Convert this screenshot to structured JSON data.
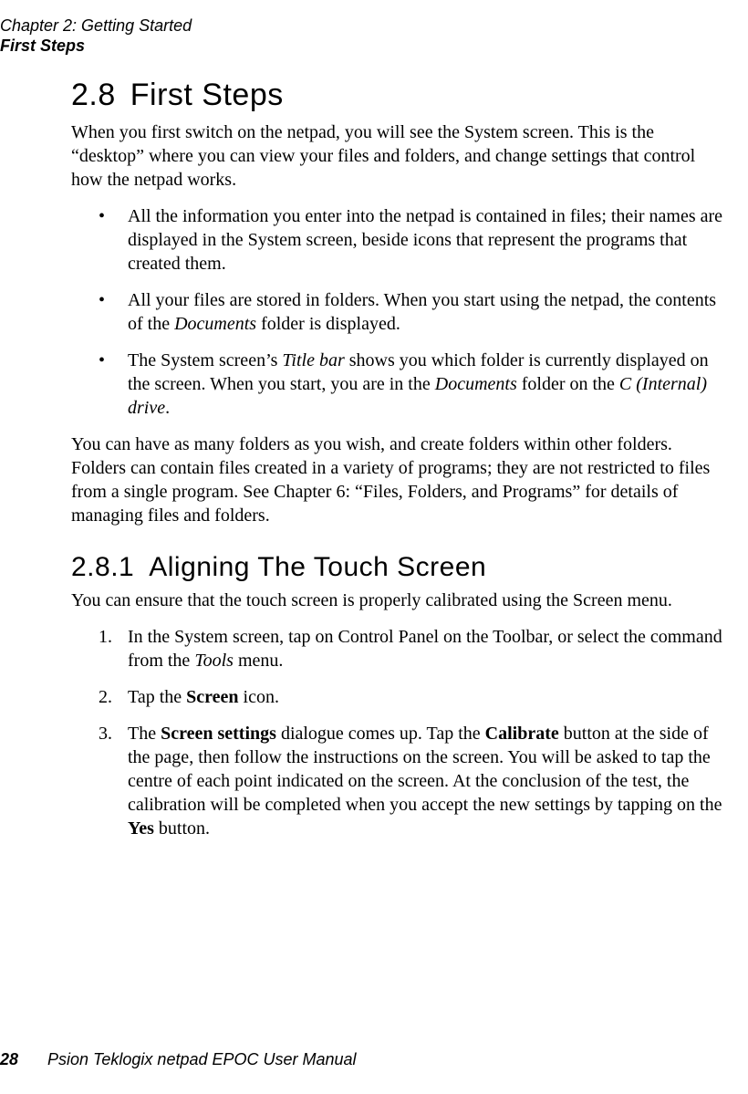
{
  "header": {
    "chapter": "Chapter 2:  Getting Started",
    "section": "First Steps"
  },
  "s28": {
    "num": "2.8",
    "title": "First Steps",
    "intro": "When you first switch on the netpad, you will see the System screen. This is the “desktop” where you can view your files and folders, and change settings that control how the netpad works.",
    "bullets": {
      "b1": "All the information you enter into the netpad is contained in files; their names are displayed in the System screen, beside icons that represent the programs that created them.",
      "b2_pre": "All your files are stored in folders. When you start using the netpad, the contents of the ",
      "b2_ital": "Documents",
      "b2_post": " folder is displayed.",
      "b3_a": "The System screen’s ",
      "b3_b": "Title bar",
      "b3_c": " shows you which folder is currently dis­played on the screen. When you start, you are in the ",
      "b3_d": "Documents",
      "b3_e": " folder on the ",
      "b3_f": "C (Internal) drive",
      "b3_g": "."
    },
    "para2": "You can have as many folders as you wish, and create folders within other folders. Folders can contain files created in a variety of programs; they are not restricted to files from a single program. See Chapter 6: “Files, Folders, and Programs” for details of managing files and folders."
  },
  "s281": {
    "num": "2.8.1",
    "title": "Aligning The Touch Screen",
    "intro": "You can ensure that the touch screen is properly calibrated using the Screen menu.",
    "steps": {
      "s1_a": "In the System screen, tap on Control Panel on the Toolbar, or select the command from the ",
      "s1_b": "Tools",
      "s1_c": " menu.",
      "s2_a": "Tap the ",
      "s2_b": "Screen",
      "s2_c": " icon.",
      "s3_a": "The ",
      "s3_b": "Screen settings",
      "s3_c": " dialogue comes up. Tap the ",
      "s3_d": "Calibrate",
      "s3_e": " button at the side of the page, then follow the instructions on the screen. You will be asked to tap the centre of each point indicated on the screen. At the conclusion of the test, the calibration will be completed when you accept the new settings by tapping on the ",
      "s3_f": "Yes",
      "s3_g": " button."
    }
  },
  "footer": {
    "page": "28",
    "manual": "Psion Teklogix netpad EPOC User Manual"
  }
}
